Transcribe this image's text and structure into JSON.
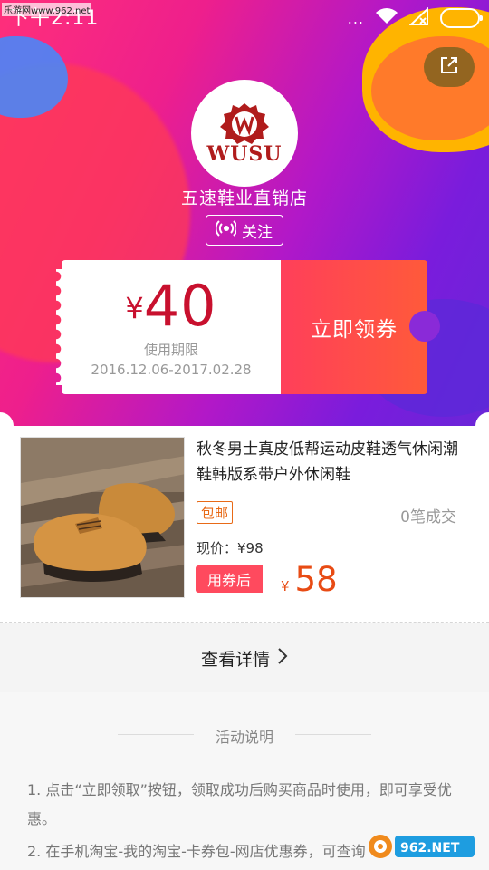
{
  "status_bar": {
    "time": "下午2:11",
    "dots": "...",
    "source_mark": "乐游网www.962.net"
  },
  "shop": {
    "logo_text": "WUSU",
    "name": "五速鞋业直销店",
    "follow_label": "关注"
  },
  "coupon": {
    "currency": "¥",
    "amount": "40",
    "period_label": "使用期限",
    "period": "2016.12.06-2017.02.28",
    "claim_label": "立即领券"
  },
  "product": {
    "title": "秋冬男士真皮低帮运动皮鞋透气休闲潮鞋韩版系带户外休闲鞋",
    "free_shipping": "包邮",
    "sales": "0笔成交",
    "current_price": "现价：¥98",
    "coupon_tag": "用券后",
    "final_currency": "¥",
    "final_price": "58"
  },
  "detail": {
    "label": "查看详情"
  },
  "activity": {
    "title": "活动说明",
    "items": [
      "1. 点击“立即领取”按钮，领取成功后购买商品时使用，即可享受优惠。",
      "2. 在手机淘宝-我的淘宝-卡券包-网店优惠券，可查询"
    ]
  },
  "watermark": {
    "text": "962.NET",
    "sub": "乐游网"
  },
  "colors": {
    "accent_red": "#c8102e",
    "coupon_gradient": "#ff4a5e",
    "price_orange": "#e84b14",
    "tag_orange": "#e86a17"
  }
}
